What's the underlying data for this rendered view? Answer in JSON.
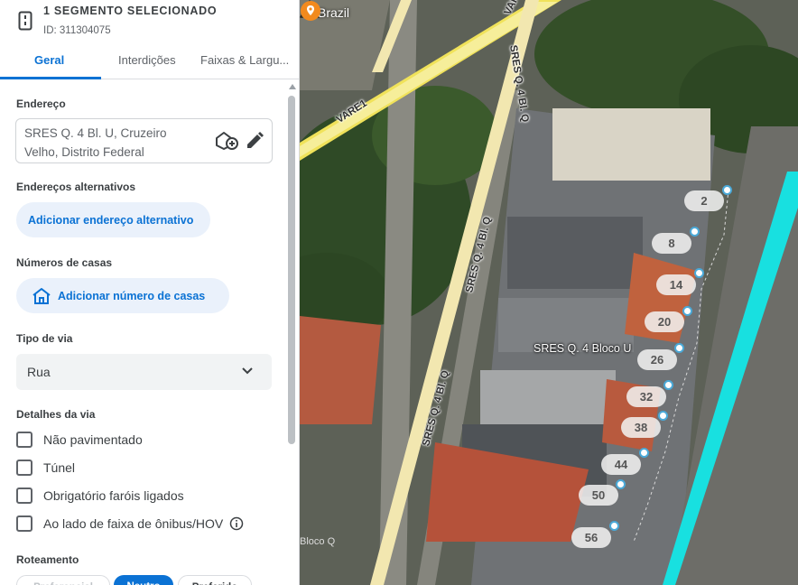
{
  "panel": {
    "title": "1 SEGMENTO SELECIONADO",
    "id_text": "ID: 311304075",
    "tabs": [
      {
        "label": "Geral",
        "active": true
      },
      {
        "label": "Interdições",
        "active": false
      },
      {
        "label": "Faixas & Largu...",
        "active": false
      }
    ],
    "address": {
      "label": "Endereço",
      "value": "SRES Q. 4 Bl. U, Cruzeiro Velho, Distrito Federal"
    },
    "alt_address": {
      "label": "Endereços alternativos",
      "button": "Adicionar endereço alternativo"
    },
    "house_numbers": {
      "label": "Números de casas",
      "button": "Adicionar número de casas"
    },
    "road_type": {
      "label": "Tipo de via",
      "value": "Rua"
    },
    "road_details": {
      "label": "Detalhes da via",
      "options": [
        "Não pavimentado",
        "Túnel",
        "Obrigatório faróis ligados",
        "Ao lado de faixa de ônibus/HOV"
      ]
    },
    "routing": {
      "label": "Roteamento",
      "options": [
        "Preferencial",
        "Neutro",
        "Preferido"
      ],
      "selected": "Neutro"
    },
    "accent_color": "#0b72d4"
  },
  "map": {
    "country": "Brazil",
    "poi_label": "SRES Q. 4 Bloco U",
    "street_labels": [
      "SRES Q. 4 Bl. Q",
      "VARE1",
      "SRES Q. 4 Bl. Q",
      "SRES Q. 4 Bl. Q",
      "VAR"
    ],
    "partial_label": "Bloco Q",
    "house_numbers": [
      "2",
      "8",
      "14",
      "20",
      "26",
      "32",
      "38",
      "44",
      "50",
      "56"
    ],
    "segment_color": "#f2e7b0",
    "highlight_color": "#18e0e0"
  }
}
